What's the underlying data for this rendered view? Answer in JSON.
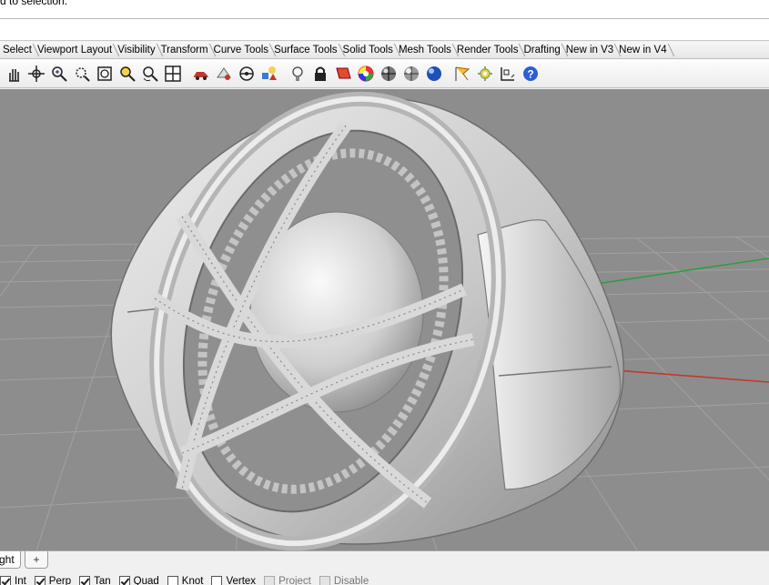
{
  "command": {
    "prompt_text": "d to selection."
  },
  "toolbar_tabs": [
    {
      "label": "Select",
      "name": "tab-select"
    },
    {
      "label": "Viewport Layout",
      "name": "tab-viewport-layout"
    },
    {
      "label": "Visibility",
      "name": "tab-visibility"
    },
    {
      "label": "Transform",
      "name": "tab-transform"
    },
    {
      "label": "Curve Tools",
      "name": "tab-curve-tools"
    },
    {
      "label": "Surface Tools",
      "name": "tab-surface-tools"
    },
    {
      "label": "Solid Tools",
      "name": "tab-solid-tools"
    },
    {
      "label": "Mesh Tools",
      "name": "tab-mesh-tools"
    },
    {
      "label": "Render Tools",
      "name": "tab-render-tools"
    },
    {
      "label": "Drafting",
      "name": "tab-drafting"
    },
    {
      "label": "New in V3",
      "name": "tab-new-in-v3"
    },
    {
      "label": "New in V4",
      "name": "tab-new-in-v4"
    }
  ],
  "toolbar_icons": [
    "pan-hand-icon",
    "rotate-view-icon",
    "zoom-dynamic-icon",
    "zoom-window-icon",
    "zoom-extents-icon",
    "zoom-selected-icon",
    "rotate-camera-icon",
    "four-viewports-icon",
    "car-render-icon",
    "properties-icon",
    "clipping-plane-icon",
    "layer-shapes-icon",
    "lightbulb-icon",
    "lock-icon",
    "hide-icon",
    "color-wheel-icon",
    "shaded-sphere-icon",
    "rendered-sphere-icon",
    "blue-sphere-icon",
    "flag-icon",
    "gear-options-icon",
    "grid-snap-icon",
    "help-icon"
  ],
  "colors": {
    "viewport_bg": "#8a8a8a",
    "grid": "#a8a8a8",
    "x_axis": "#c0392b",
    "y_axis": "#2e9e3e",
    "model": "#dcdcdc"
  },
  "viewport_tab": {
    "label": "ght",
    "add_label": "+"
  },
  "osnaps": [
    {
      "label": "Int",
      "checked": true,
      "disabled": false
    },
    {
      "label": "Perp",
      "checked": true,
      "disabled": false
    },
    {
      "label": "Tan",
      "checked": true,
      "disabled": false
    },
    {
      "label": "Quad",
      "checked": true,
      "disabled": false
    },
    {
      "label": "Knot",
      "checked": false,
      "disabled": false
    },
    {
      "label": "Vertex",
      "checked": false,
      "disabled": false
    },
    {
      "label": "Project",
      "checked": false,
      "disabled": true
    },
    {
      "label": "Disable",
      "checked": false,
      "disabled": true
    }
  ]
}
